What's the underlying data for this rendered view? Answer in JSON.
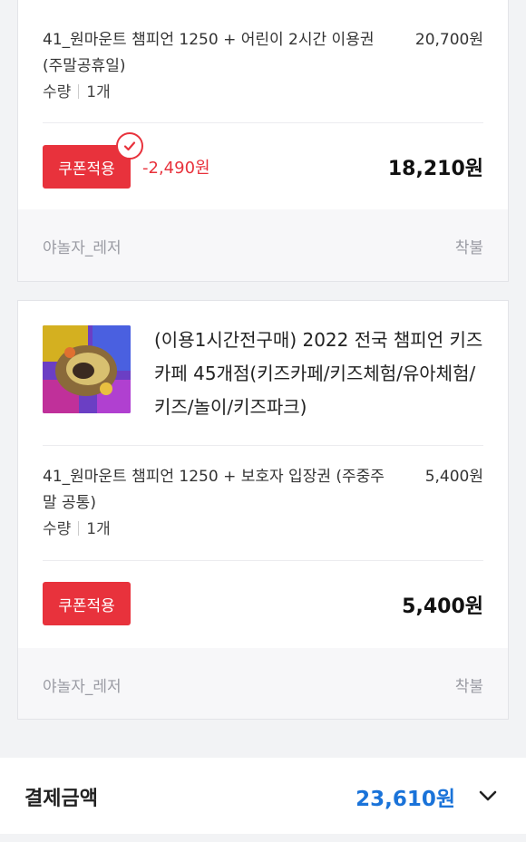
{
  "items": [
    {
      "option_name": "41_원마운트 챔피언 1250 + 어린이 2시간 이용권 (주말공휴일)",
      "option_price": "20,700원",
      "qty_label": "수량",
      "qty_value": "1개",
      "coupon_label": "쿠폰적용",
      "coupon_applied": true,
      "discount": "-2,490원",
      "final_price": "18,210원",
      "seller": "야놀자_레저",
      "shipping": "착불"
    },
    {
      "product_title": "(이용1시간전구매) 2022 전국 챔피언 키즈카페 45개점(키즈카페/키즈체험/유아체험/키즈/놀이/키즈파크)",
      "option_name": "41_원마운트 챔피언 1250 + 보호자 입장권 (주중주말 공통)",
      "option_price": "5,400원",
      "qty_label": "수량",
      "qty_value": "1개",
      "coupon_label": "쿠폰적용",
      "coupon_applied": false,
      "final_price": "5,400원",
      "seller": "야놀자_레저",
      "shipping": "착불"
    }
  ],
  "payment": {
    "label": "결제금액",
    "amount": "23,610원",
    "toggle_icon": "chevron-down-icon"
  },
  "colors": {
    "accent_red": "#e8323c",
    "accent_blue": "#1a73d9",
    "muted_text": "#9a9ba3"
  }
}
